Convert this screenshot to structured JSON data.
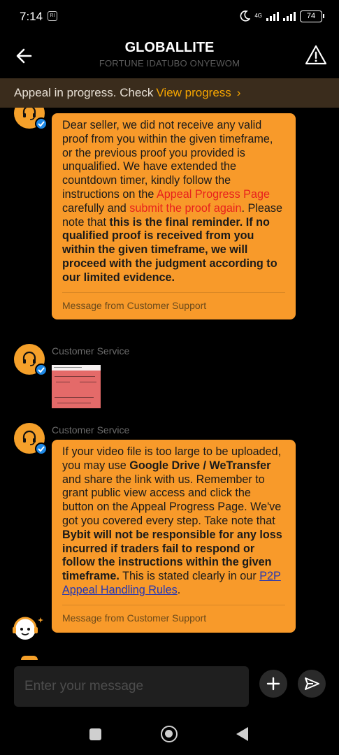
{
  "status_bar": {
    "time": "7:14",
    "badge": "RI",
    "network": "4G",
    "battery": "74"
  },
  "header": {
    "title": "GLOBALLITE",
    "subtitle": "FORTUNE IDATUBO ONYEWOM"
  },
  "banner": {
    "text": "Appeal in progress. Check",
    "link": "View progress",
    "chevron": "›"
  },
  "messages": [
    {
      "sender": "",
      "type": "text",
      "segments": [
        "Dear seller, we did not receive any valid proof from you within the given timeframe, or the previous proof you provided is unqualified. We have extended the countdown timer, kindly follow the instructions on the ",
        "Appeal Progress Page",
        " carefully and ",
        "submit the proof again",
        ". Please note that ",
        "this is the final reminder. If no qualified proof is received from you within the given timeframe, we will proceed with the judgment according to our limited evidence."
      ],
      "footer": "Message from Customer Support"
    },
    {
      "sender": "Customer Service",
      "type": "image"
    },
    {
      "sender": "Customer Service",
      "type": "text",
      "segments": [
        "If your video file is too large to be uploaded, you may use ",
        "Google Drive / WeTransfer",
        " and share the link with us. Remember to grant public view access and click the button on the Appeal Progress Page. We've got you covered every step. Take note that ",
        "Bybit will not be responsible for any loss incurred if traders fail to respond or follow the instructions within the given timeframe.",
        " This is stated clearly in our ",
        "P2P Appeal Handling Rules",
        "."
      ],
      "footer": "Message from Customer Support"
    }
  ],
  "input": {
    "placeholder": "Enter your message"
  },
  "colors": {
    "accent": "#f7a600",
    "bubble": "#f89a2a",
    "highlight_red": "#e8211d",
    "link_blue": "#2436b5",
    "banner_bg": "#3a2c1c"
  },
  "icons": {
    "back": "arrow-left-icon",
    "warning": "warning-triangle-icon",
    "avatar": "headset-icon",
    "verified": "verified-check-icon",
    "plus": "plus-icon",
    "send": "send-icon",
    "assistant": "chat-bot-icon"
  }
}
